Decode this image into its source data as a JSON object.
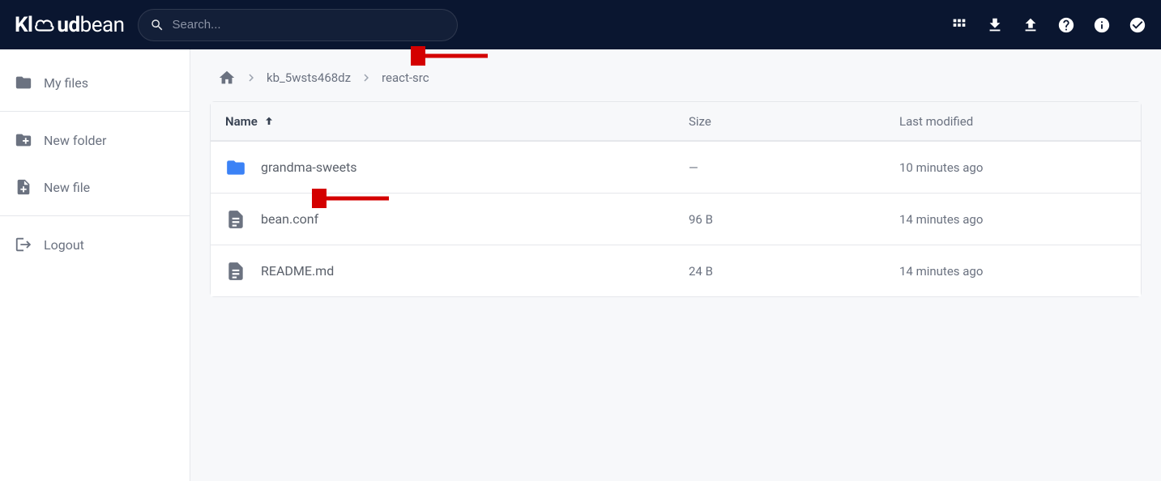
{
  "brand": {
    "part1": "Kl",
    "part2": "ud",
    "part3": "bean"
  },
  "search": {
    "placeholder": "Search..."
  },
  "sidebar": {
    "items": [
      {
        "label": "My files",
        "icon": "folder-icon"
      },
      {
        "label": "New folder",
        "icon": "add-folder-icon"
      },
      {
        "label": "New file",
        "icon": "add-file-icon"
      },
      {
        "label": "Logout",
        "icon": "logout-icon"
      }
    ]
  },
  "breadcrumb": {
    "parts": [
      "kb_5wsts468dz",
      "react-src"
    ]
  },
  "table": {
    "headers": {
      "name": "Name",
      "size": "Size",
      "modified": "Last modified"
    },
    "rows": [
      {
        "name": "grandma-sweets",
        "size": "—",
        "modified": "10 minutes ago",
        "type": "folder"
      },
      {
        "name": "bean.conf",
        "size": "96 B",
        "modified": "14 minutes ago",
        "type": "file"
      },
      {
        "name": "README.md",
        "size": "24 B",
        "modified": "14 minutes ago",
        "type": "file"
      }
    ]
  }
}
